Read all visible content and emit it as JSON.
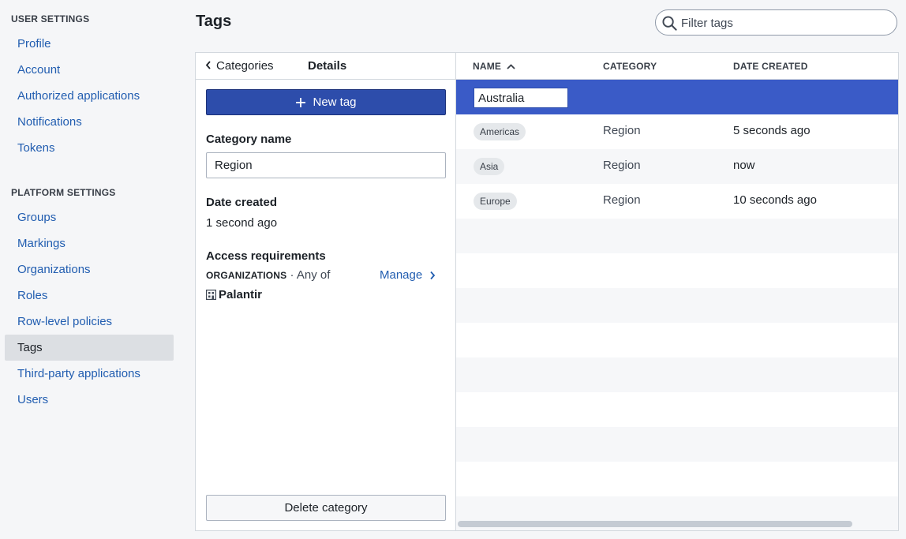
{
  "sidebar": {
    "user_settings_header": "USER SETTINGS",
    "user_items": [
      "Profile",
      "Account",
      "Authorized applications",
      "Notifications",
      "Tokens"
    ],
    "platform_settings_header": "PLATFORM SETTINGS",
    "platform_items": [
      "Groups",
      "Markings",
      "Organizations",
      "Roles",
      "Row-level policies",
      "Tags",
      "Third-party applications",
      "Users"
    ],
    "active_item": "Tags"
  },
  "page": {
    "title": "Tags",
    "search_placeholder": "Filter tags"
  },
  "details": {
    "back_tab": "Categories",
    "active_tab": "Details",
    "new_tag_label": "New tag",
    "category_name_label": "Category name",
    "category_name_value": "Region",
    "date_created_label": "Date created",
    "date_created_value": "1 second ago",
    "access_label": "Access requirements",
    "org_caps": "ORGANIZATIONS",
    "org_suffix": "· Any of",
    "manage_label": "Manage",
    "org_name": "Palantir",
    "delete_label": "Delete category"
  },
  "table": {
    "columns": [
      "NAME",
      "CATEGORY",
      "DATE CREATED"
    ],
    "editing_value": "Australia",
    "rows": [
      {
        "name": "Americas",
        "category": "Region",
        "date": "5 seconds ago"
      },
      {
        "name": "Asia",
        "category": "Region",
        "date": "now"
      },
      {
        "name": "Europe",
        "category": "Region",
        "date": "10 seconds ago"
      }
    ]
  },
  "colors": {
    "primary": "#2d4dab",
    "selected_row": "#3a5bc7",
    "link": "#215db0",
    "active_nav": "#dcdfe3"
  }
}
